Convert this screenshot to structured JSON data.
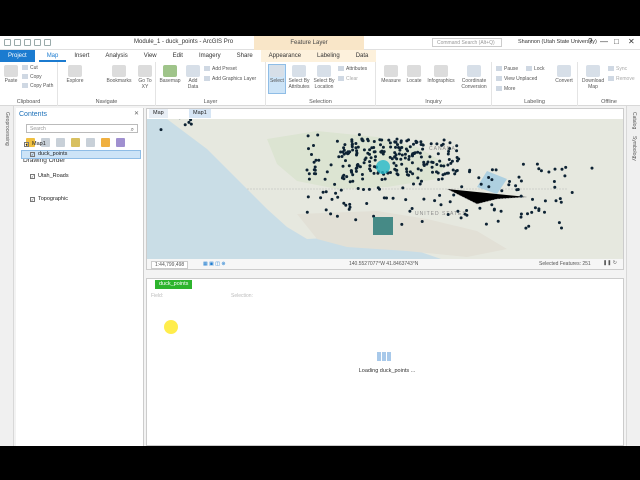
{
  "window": {
    "title": "Module_1 - duck_points - ArcGIS Pro",
    "context_group": "Feature Layer",
    "search_placeholder": "Command Search (Alt+Q)",
    "user": "Shannon (Utah State University)",
    "controls": [
      "?",
      "—",
      "□",
      "✕"
    ]
  },
  "tabs": [
    "Project",
    "Map",
    "Insert",
    "Analysis",
    "View",
    "Edit",
    "Imagery",
    "Share",
    "Appearance",
    "Labeling",
    "Data"
  ],
  "active_tab": "Map",
  "ribbon": {
    "clipboard": {
      "label": "Clipboard",
      "paste": "Paste",
      "cut": "Cut",
      "copy": "Copy",
      "copy_path": "Copy Path"
    },
    "navigate": {
      "label": "Navigate",
      "explore": "Explore",
      "bookmarks": "Bookmarks",
      "goto": "Go To XY"
    },
    "layer": {
      "label": "Layer",
      "basemap": "Basemap",
      "add_data": "Add Data",
      "add_preset": "Add Preset",
      "add_graphics": "Add Graphics Layer"
    },
    "selection": {
      "label": "Selection",
      "select": "Select",
      "by_attributes": "Select By Attributes",
      "by_location": "Select By Location",
      "attributes": "Attributes",
      "clear": "Clear"
    },
    "inquiry": {
      "label": "Inquiry",
      "measure": "Measure",
      "locate": "Locate",
      "infographics": "Infographics",
      "coord": "Coordinate Conversion"
    },
    "labeling": {
      "label": "Labeling",
      "pause": "Pause",
      "lock": "Lock",
      "view_unplaced": "View Unplaced",
      "more": "More"
    },
    "offline": {
      "label": "Offline",
      "convert": "Convert",
      "download": "Download Map",
      "sync": "Sync",
      "remove": "Remove"
    }
  },
  "contents": {
    "title": "Contents",
    "search_placeholder": "Search",
    "section": "Drawing Order",
    "items": [
      "Map1",
      "duck_points",
      "Utah_Roads",
      "Topographic"
    ]
  },
  "left_strip": "Geoprocessing",
  "right_strip": [
    "Catalog",
    "Symbology"
  ],
  "map": {
    "tab": "Map",
    "subtab": "Map1",
    "scale": "1:44,799,498",
    "coords": "140.5527077°W 41.8463743°N",
    "selected": "Selected Features: 251",
    "countries": [
      "CANADA",
      "UNITED STATES"
    ]
  },
  "table": {
    "tab": "duck_points",
    "toolbar_items": [
      "Field:",
      "Selection:"
    ],
    "loading": "Loading duck_points ..."
  },
  "colors": {
    "accent": "#1b7bd0",
    "points": "#0d2233",
    "highlight": "#26b9c9",
    "table_tab": "#2db42d"
  }
}
